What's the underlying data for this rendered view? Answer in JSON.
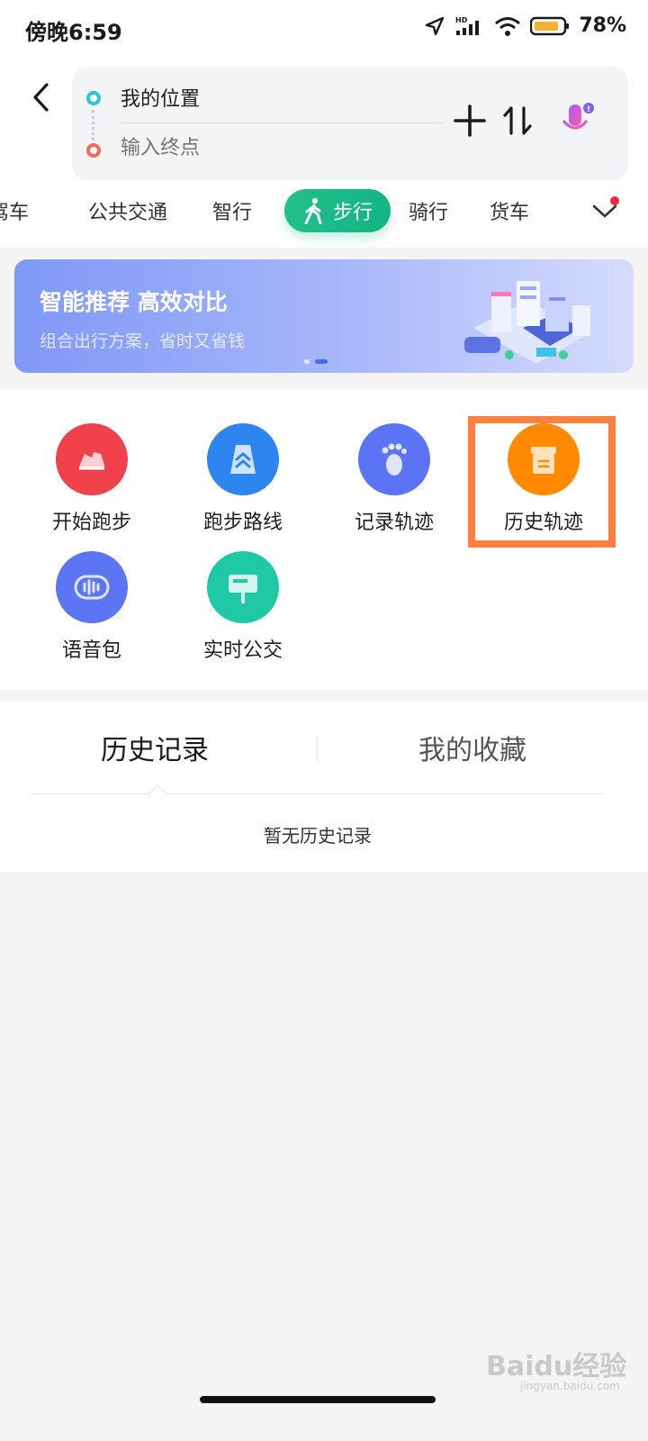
{
  "status_bar": {
    "time": "傍晚6:59",
    "battery": "78%",
    "network": "HD"
  },
  "route": {
    "start_label": "我的位置",
    "end_placeholder": "输入终点"
  },
  "modes": {
    "drive": "驾车",
    "transit": "公共交通",
    "smart": "智行",
    "walk": "步行",
    "bike": "骑行",
    "truck": "货车"
  },
  "banner": {
    "title": "智能推荐 高效对比",
    "subtitle": "组合出行方案，省时又省钱"
  },
  "tools": [
    {
      "label": "开始跑步",
      "color": "#f0424c"
    },
    {
      "label": "跑步路线",
      "color": "#2d86f0"
    },
    {
      "label": "记录轨迹",
      "color": "#5a74f5"
    },
    {
      "label": "历史轨迹",
      "color": "#ff8a00"
    },
    {
      "label": "语音包",
      "color": "#5c75f3"
    },
    {
      "label": "实时公交",
      "color": "#20c9a6"
    }
  ],
  "history": {
    "tab_history": "历史记录",
    "tab_favorites": "我的收藏",
    "empty_text": "暂无历史记录"
  },
  "watermark": {
    "text": "Baidu经验",
    "sub": "jingyan.baidu.com"
  }
}
